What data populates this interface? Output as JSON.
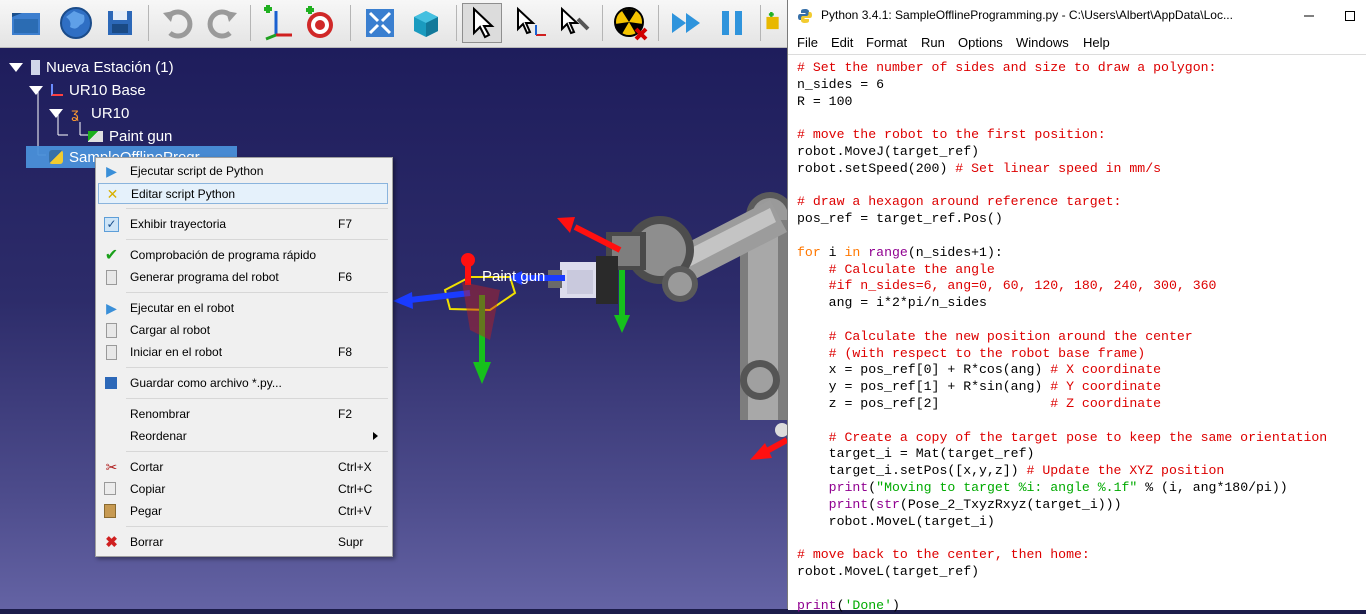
{
  "robodk": {
    "toolbar": {
      "buttons": [
        "open-icon",
        "web-icon",
        "save-icon",
        "undo-icon",
        "redo-icon",
        "add-frame-icon",
        "add-target-icon",
        "fit-all-icon",
        "3d-view-icon",
        "select-icon",
        "move-reference-icon",
        "move-tool-icon",
        "collision-icon",
        "fast-simulation-icon",
        "pause-icon"
      ]
    },
    "tree": {
      "station": "Nueva Estación (1)",
      "base": "UR10 Base",
      "robot": "UR10",
      "tool": "Paint gun",
      "program": "SampleOfflineProgr"
    },
    "scene": {
      "tool_label": "Paint gun"
    },
    "context_menu": {
      "items": [
        {
          "label": "Ejecutar script de Python",
          "shortcut": "",
          "icon": "run-icon"
        },
        {
          "label": "Editar script Python",
          "shortcut": "",
          "icon": "edit-script-icon"
        },
        {
          "label": "Exhibir trayectoria",
          "shortcut": "F7",
          "icon": "checkbox-checked-icon"
        },
        {
          "label": "Comprobación de programa rápido",
          "shortcut": "",
          "icon": "check-icon"
        },
        {
          "label": "Generar programa del robot",
          "shortcut": "F6",
          "icon": "document-icon"
        },
        {
          "label": "Ejecutar en el robot",
          "shortcut": "",
          "icon": "run-icon"
        },
        {
          "label": "Cargar al robot",
          "shortcut": "",
          "icon": "document-icon"
        },
        {
          "label": "Iniciar en el robot",
          "shortcut": "F8",
          "icon": "document-icon"
        },
        {
          "label": "Guardar como archivo *.py...",
          "shortcut": "",
          "icon": "save-icon"
        },
        {
          "label": "Renombrar",
          "shortcut": "F2",
          "icon": ""
        },
        {
          "label": "Reordenar",
          "shortcut": "",
          "icon": ""
        },
        {
          "label": "Cortar",
          "shortcut": "Ctrl+X",
          "icon": "scissors-icon"
        },
        {
          "label": "Copiar",
          "shortcut": "Ctrl+C",
          "icon": "copy-icon"
        },
        {
          "label": "Pegar",
          "shortcut": "Ctrl+V",
          "icon": "paste-icon"
        },
        {
          "label": "Borrar",
          "shortcut": "Supr",
          "icon": "delete-icon"
        }
      ]
    }
  },
  "idle": {
    "title": "Python 3.4.1: SampleOfflineProgramming.py - C:\\Users\\Albert\\AppData\\Loc...",
    "menu": [
      "File",
      "Edit",
      "Format",
      "Run",
      "Options",
      "Windows",
      "Help"
    ],
    "code": [
      "# Set the number of sides and size to draw a polygon:",
      "n_sides = 6",
      "R = 100",
      "",
      "# move the robot to the first position:",
      "robot.MoveJ(target_ref)",
      "robot.setSpeed(200) # Set linear speed in mm/s",
      "",
      "# draw a hexagon around reference target:",
      "pos_ref = target_ref.Pos()",
      "",
      "for i in range(n_sides+1):",
      "    # Calculate the angle",
      "    #if n_sides=6, ang=0, 60, 120, 180, 240, 300, 360",
      "    ang = i*2*pi/n_sides",
      "",
      "    # Calculate the new position around the center",
      "    # (with respect to the robot base frame)",
      "    x = pos_ref[0] + R*cos(ang) # X coordinate",
      "    y = pos_ref[1] + R*sin(ang) # Y coordinate",
      "    z = pos_ref[2]              # Z coordinate",
      "",
      "    # Create a copy of the target pose to keep the same orientation",
      "    target_i = Mat(target_ref)",
      "    target_i.setPos([x,y,z]) # Update the XYZ position",
      "    print(\"Moving to target %i: angle %.1f\" % (i, ang*180/pi))",
      "    print(str(Pose_2_TxyzRxyz(target_i)))",
      "    robot.MoveL(target_i)",
      "",
      "# move back to the center, then home:",
      "robot.MoveL(target_ref)",
      "",
      "print('Done')"
    ]
  }
}
